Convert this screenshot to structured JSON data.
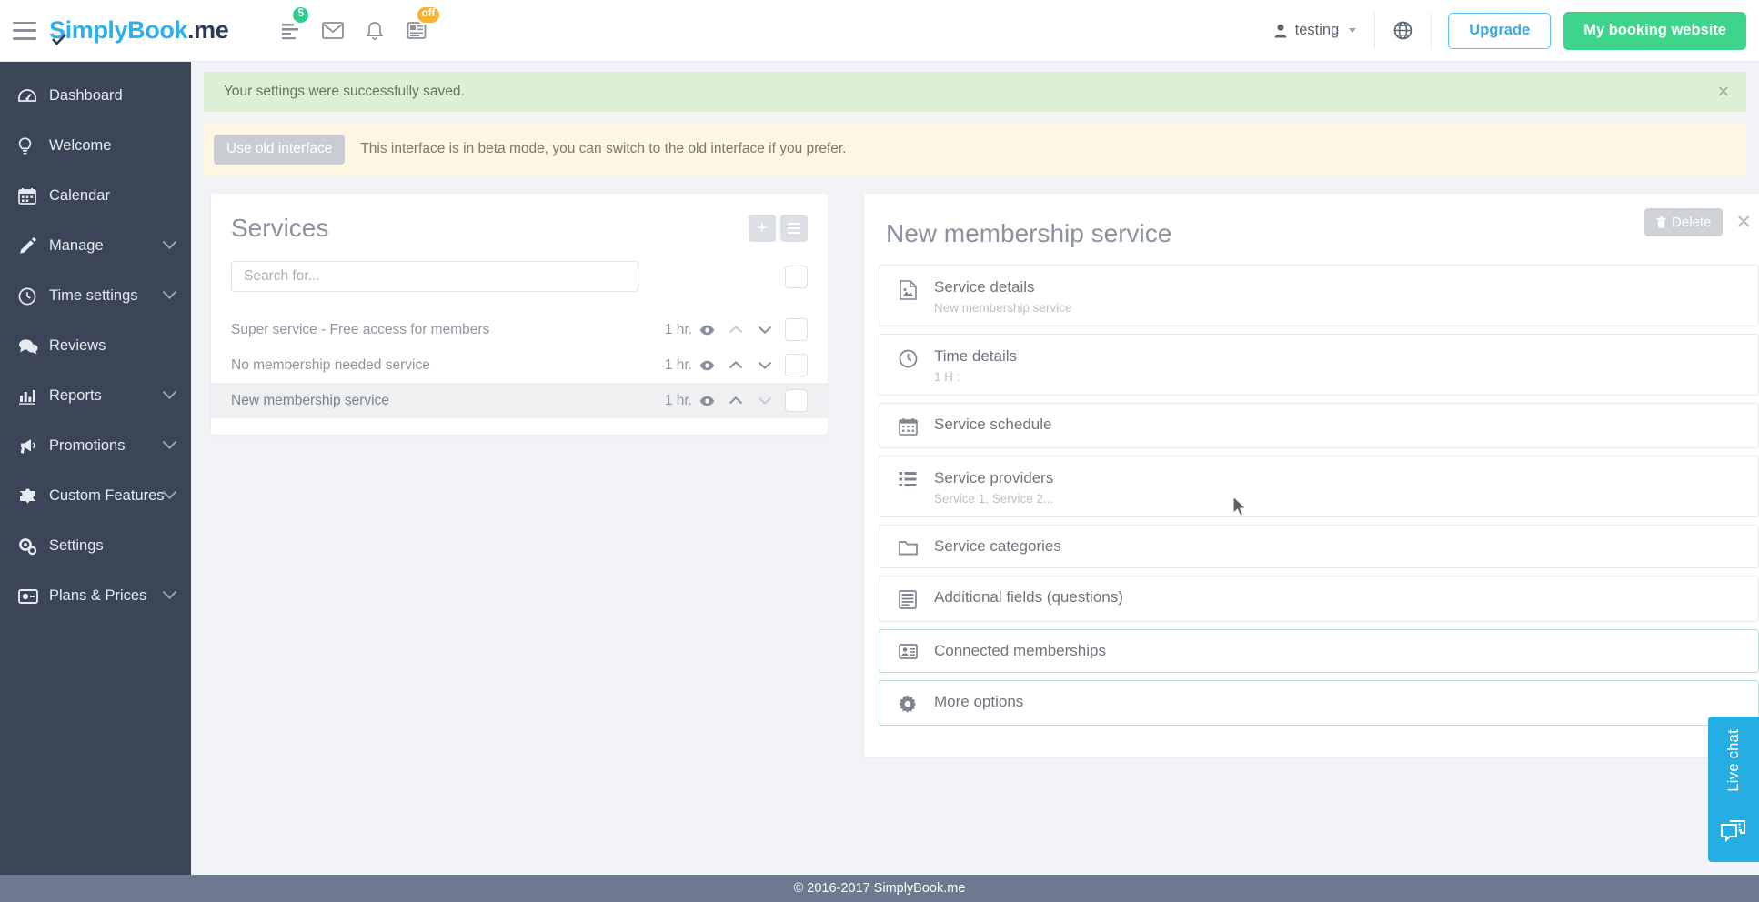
{
  "topbar": {
    "menu_icon": "hamburger-icon",
    "brand": {
      "part1": "S",
      "part2": "implyBook",
      "part3": ".me"
    },
    "icons": [
      {
        "name": "tasks-icon",
        "badge": "5",
        "badge_color": "#2ecc8f"
      },
      {
        "name": "mail-icon",
        "badge": ""
      },
      {
        "name": "bell-icon",
        "badge": ""
      },
      {
        "name": "news-icon",
        "badge": "off",
        "badge_color": "#f5b335"
      }
    ],
    "user": "testing",
    "globe_icon": "globe-icon",
    "upgrade_label": "Upgrade",
    "booking_label": "My booking website",
    "accent_blue": "#3aa9e8",
    "accent_green": "#3fd48b"
  },
  "sidebar": {
    "items": [
      {
        "label": "Dashboard",
        "icon": "dashboard-icon",
        "caret": false
      },
      {
        "label": "Welcome",
        "icon": "lightbulb-icon",
        "caret": false
      },
      {
        "label": "Calendar",
        "icon": "calendar-icon",
        "caret": false
      },
      {
        "label": "Manage",
        "icon": "pencil-icon",
        "caret": true
      },
      {
        "label": "Time settings",
        "icon": "clock-icon",
        "caret": true
      },
      {
        "label": "Reviews",
        "icon": "comments-icon",
        "caret": false
      },
      {
        "label": "Reports",
        "icon": "bar-chart-icon",
        "caret": true
      },
      {
        "label": "Promotions",
        "icon": "megaphone-icon",
        "caret": true
      },
      {
        "label": "Custom Features",
        "icon": "puzzle-icon",
        "caret": true
      },
      {
        "label": "Settings",
        "icon": "gears-icon",
        "caret": false
      },
      {
        "label": "Plans & Prices",
        "icon": "credit-card-icon",
        "caret": true
      }
    ],
    "background": "#3a4557"
  },
  "alerts": {
    "success_text": "Your settings were successfully saved.",
    "success_bg": "#ddefd6",
    "beta_button": "Use old interface",
    "beta_text": "This interface is in beta mode, you can switch to the old interface if you prefer.",
    "beta_bg": "#fdf6e3"
  },
  "services_panel": {
    "title": "Services",
    "add_button": "+",
    "menu_button": "list-icon",
    "search_placeholder": "Search for...",
    "search_value": "",
    "rows": [
      {
        "name": "Super service - Free access for members",
        "duration": "1 hr.",
        "active": false,
        "up_dim": true,
        "down_dim": false
      },
      {
        "name": "No membership needed service",
        "duration": "1 hr.",
        "active": false,
        "up_dim": false,
        "down_dim": false
      },
      {
        "name": "New membership service",
        "duration": "1 hr.",
        "active": true,
        "up_dim": false,
        "down_dim": true
      }
    ]
  },
  "detail_panel": {
    "title": "New membership service",
    "delete_label": "Delete",
    "close_icon": "close-icon",
    "sections": [
      {
        "label": "Service details",
        "sub": "New membership service",
        "icon": "image-file-icon",
        "highlight": false
      },
      {
        "label": "Time details",
        "sub": "1 H :",
        "icon": "clock-icon",
        "highlight": false
      },
      {
        "label": "Service schedule",
        "sub": "",
        "icon": "calendar-icon",
        "highlight": false
      },
      {
        "label": "Service providers",
        "sub": "Service 1, Service 2...",
        "icon": "list-icon",
        "highlight": false
      },
      {
        "label": "Service categories",
        "sub": "",
        "icon": "folder-icon",
        "highlight": false
      },
      {
        "label": "Additional fields (questions)",
        "sub": "",
        "icon": "form-icon",
        "highlight": false
      },
      {
        "label": "Connected memberships",
        "sub": "",
        "icon": "id-card-icon",
        "highlight": true
      },
      {
        "label": "More options",
        "sub": "",
        "icon": "gear-icon",
        "highlight": true
      }
    ]
  },
  "livechat": {
    "label": "Live chat",
    "icon": "chat-bubble-icon",
    "color": "#24aee4"
  },
  "footer": {
    "text": "© 2016-2017 SimplyBook.me",
    "bg": "#6c798f"
  }
}
